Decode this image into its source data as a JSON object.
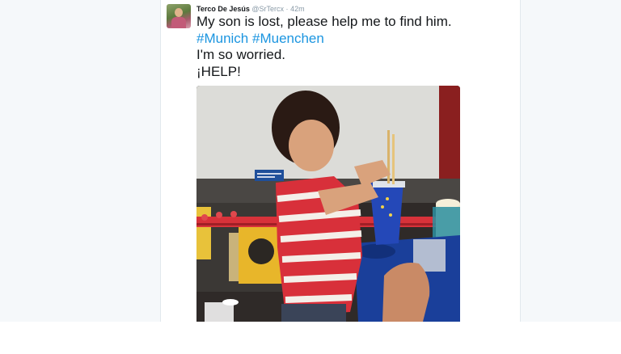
{
  "tweet": {
    "display_name": "Terco De Jesús",
    "handle": "@SrTercx",
    "separator": "·",
    "time": "42m",
    "lines": [
      "My son is lost, please help me to find him.",
      "I'm so worried.",
      "¡HELP!"
    ],
    "hashtags": [
      "#Munich",
      "#Muenchen"
    ],
    "photo_label": "child-in-cinema-photo"
  },
  "colors": {
    "background": "#f5f8fa",
    "card": "#ffffff",
    "text": "#14171a",
    "secondary": "#8899a6",
    "link": "#1b95e0",
    "border": "#e1e8ed"
  }
}
